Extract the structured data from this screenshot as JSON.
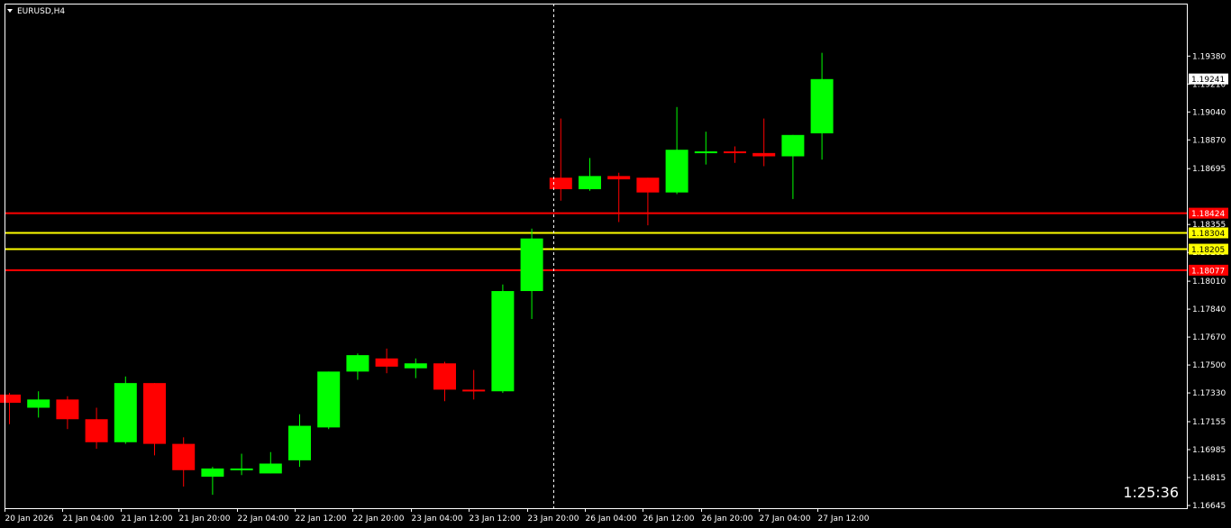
{
  "window": {
    "symbol_label": "EURUSD,H4",
    "countdown": "1:25:36"
  },
  "colors": {
    "background": "#000000",
    "frame": "#ffffff",
    "bull": "#00ff00",
    "bear": "#ff0000",
    "crosshair": "#ffffff",
    "level_red": "#ff0000",
    "level_yellow": "#ffff00",
    "bid_badge": "#ffffff"
  },
  "chart_data": {
    "type": "candlestick",
    "symbol": "EURUSD",
    "timeframe": "H4",
    "ylim": [
      1.16645,
      1.19535
    ],
    "y_ticks": [
      "1.19380",
      "1.19210",
      "1.19040",
      "1.18870",
      "1.18695",
      "1.18355",
      "1.18185",
      "1.18010",
      "1.17840",
      "1.17670",
      "1.17500",
      "1.17330",
      "1.17155",
      "1.16985",
      "1.16815",
      "1.16645"
    ],
    "x_ticks": [
      "20 Jan 2026",
      "21 Jan 04:00",
      "21 Jan 12:00",
      "21 Jan 20:00",
      "22 Jan 04:00",
      "22 Jan 12:00",
      "22 Jan 20:00",
      "23 Jan 04:00",
      "23 Jan 12:00",
      "23 Jan 20:00",
      "26 Jan 04:00",
      "26 Jan 12:00",
      "26 Jan 20:00",
      "27 Jan 04:00",
      "27 Jan 12:00"
    ],
    "candles": [
      {
        "o": 1.1732,
        "h": 1.1733,
        "l": 1.1714,
        "c": 1.1727
      },
      {
        "o": 1.1724,
        "h": 1.1734,
        "l": 1.1718,
        "c": 1.1729
      },
      {
        "o": 1.1729,
        "h": 1.1731,
        "l": 1.1711,
        "c": 1.1717
      },
      {
        "o": 1.1717,
        "h": 1.1724,
        "l": 1.1699,
        "c": 1.1703
      },
      {
        "o": 1.1703,
        "h": 1.1743,
        "l": 1.1702,
        "c": 1.1739
      },
      {
        "o": 1.1739,
        "h": 1.1739,
        "l": 1.1695,
        "c": 1.1702
      },
      {
        "o": 1.1702,
        "h": 1.1706,
        "l": 1.1676,
        "c": 1.1686
      },
      {
        "o": 1.1682,
        "h": 1.1688,
        "l": 1.1671,
        "c": 1.1687
      },
      {
        "o": 1.1686,
        "h": 1.1696,
        "l": 1.1683,
        "c": 1.1687
      },
      {
        "o": 1.1684,
        "h": 1.1697,
        "l": 1.1684,
        "c": 1.169
      },
      {
        "o": 1.1692,
        "h": 1.172,
        "l": 1.1688,
        "c": 1.1713
      },
      {
        "o": 1.1712,
        "h": 1.1746,
        "l": 1.1711,
        "c": 1.1746
      },
      {
        "o": 1.1746,
        "h": 1.1757,
        "l": 1.1741,
        "c": 1.1756
      },
      {
        "o": 1.1754,
        "h": 1.176,
        "l": 1.1745,
        "c": 1.1749
      },
      {
        "o": 1.1748,
        "h": 1.1754,
        "l": 1.1742,
        "c": 1.1751
      },
      {
        "o": 1.1751,
        "h": 1.1752,
        "l": 1.1728,
        "c": 1.1735
      },
      {
        "o": 1.1735,
        "h": 1.1747,
        "l": 1.1729,
        "c": 1.1734
      },
      {
        "o": 1.1734,
        "h": 1.1799,
        "l": 1.1733,
        "c": 1.1795
      },
      {
        "o": 1.1795,
        "h": 1.1833,
        "l": 1.1778,
        "c": 1.1827
      },
      {
        "o": 1.1864,
        "h": 1.19,
        "l": 1.185,
        "c": 1.1857
      },
      {
        "o": 1.1857,
        "h": 1.1876,
        "l": 1.1856,
        "c": 1.1865
      },
      {
        "o": 1.1865,
        "h": 1.1867,
        "l": 1.1837,
        "c": 1.1863
      },
      {
        "o": 1.1864,
        "h": 1.1864,
        "l": 1.1835,
        "c": 1.1855
      },
      {
        "o": 1.1855,
        "h": 1.1907,
        "l": 1.1854,
        "c": 1.1881
      },
      {
        "o": 1.188,
        "h": 1.1892,
        "l": 1.1872,
        "c": 1.188
      },
      {
        "o": 1.188,
        "h": 1.1883,
        "l": 1.1873,
        "c": 1.1879
      },
      {
        "o": 1.1879,
        "h": 1.19,
        "l": 1.1871,
        "c": 1.1877
      },
      {
        "o": 1.1877,
        "h": 1.189,
        "l": 1.1851,
        "c": 1.189
      },
      {
        "o": 1.1891,
        "h": 1.194,
        "l": 1.1875,
        "c": 1.1924
      }
    ],
    "levels": [
      {
        "price": 1.18424,
        "label": "1.18424",
        "color": "#ff0000"
      },
      {
        "price": 1.18304,
        "label": "1.18304",
        "color": "#ffff00"
      },
      {
        "price": 1.18205,
        "label": "1.18205",
        "color": "#ffff00"
      },
      {
        "price": 1.18077,
        "label": "1.18077",
        "color": "#ff0000"
      }
    ],
    "bid": {
      "price": 1.19241,
      "label": "1.19241"
    },
    "crosshair_after_candle": 18,
    "grid": false
  }
}
